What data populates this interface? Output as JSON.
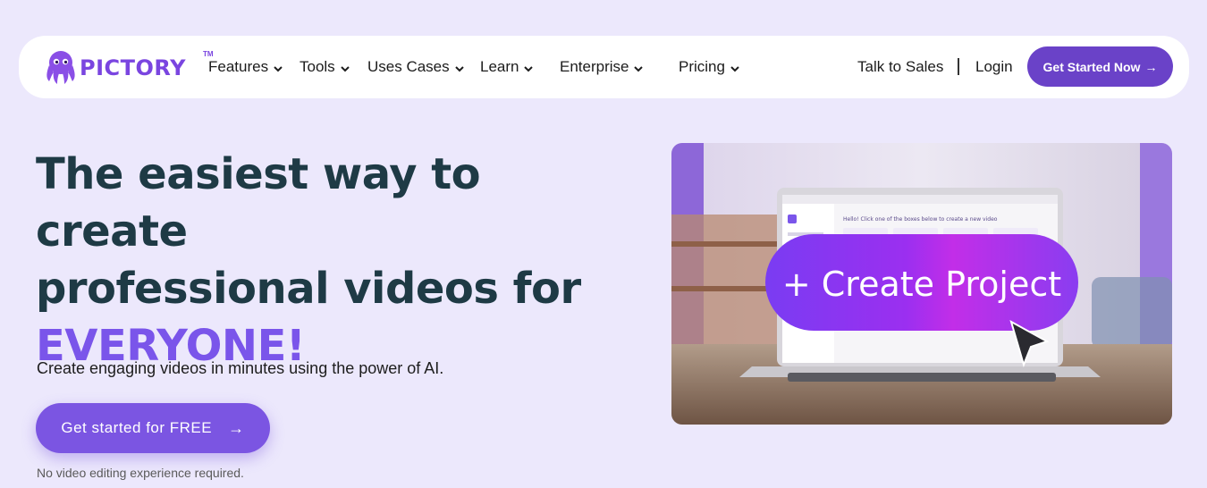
{
  "brand": {
    "name": "PICTORY",
    "tm": "TM",
    "color": "#7a45e0"
  },
  "nav": {
    "items": [
      {
        "label": "Features"
      },
      {
        "label": "Tools"
      },
      {
        "label": "Uses Cases"
      },
      {
        "label": "Learn"
      },
      {
        "label": "Enterprise"
      },
      {
        "label": "Pricing"
      }
    ],
    "talk_to_sales": "Talk to Sales",
    "login": "Login",
    "get_started": "Get Started Now",
    "arrow": "→"
  },
  "hero": {
    "title_line1": "The easiest way to create",
    "title_line2": "professional videos for",
    "title_accent": "EVERYONE!",
    "subtitle": "Create engaging videos in minutes using the power of AI.",
    "cta": "Get started for FREE",
    "cta_arrow": "→",
    "note": "No video editing experience required."
  },
  "hero_image": {
    "create_project_label": "+ Create Project",
    "screen_greeting": "Hello! Click one of the boxes below to create a new video"
  },
  "colors": {
    "page_bg": "#ece8fc",
    "accent": "#7a55ea",
    "button": "#6a42c8",
    "title": "#1e3a45"
  }
}
